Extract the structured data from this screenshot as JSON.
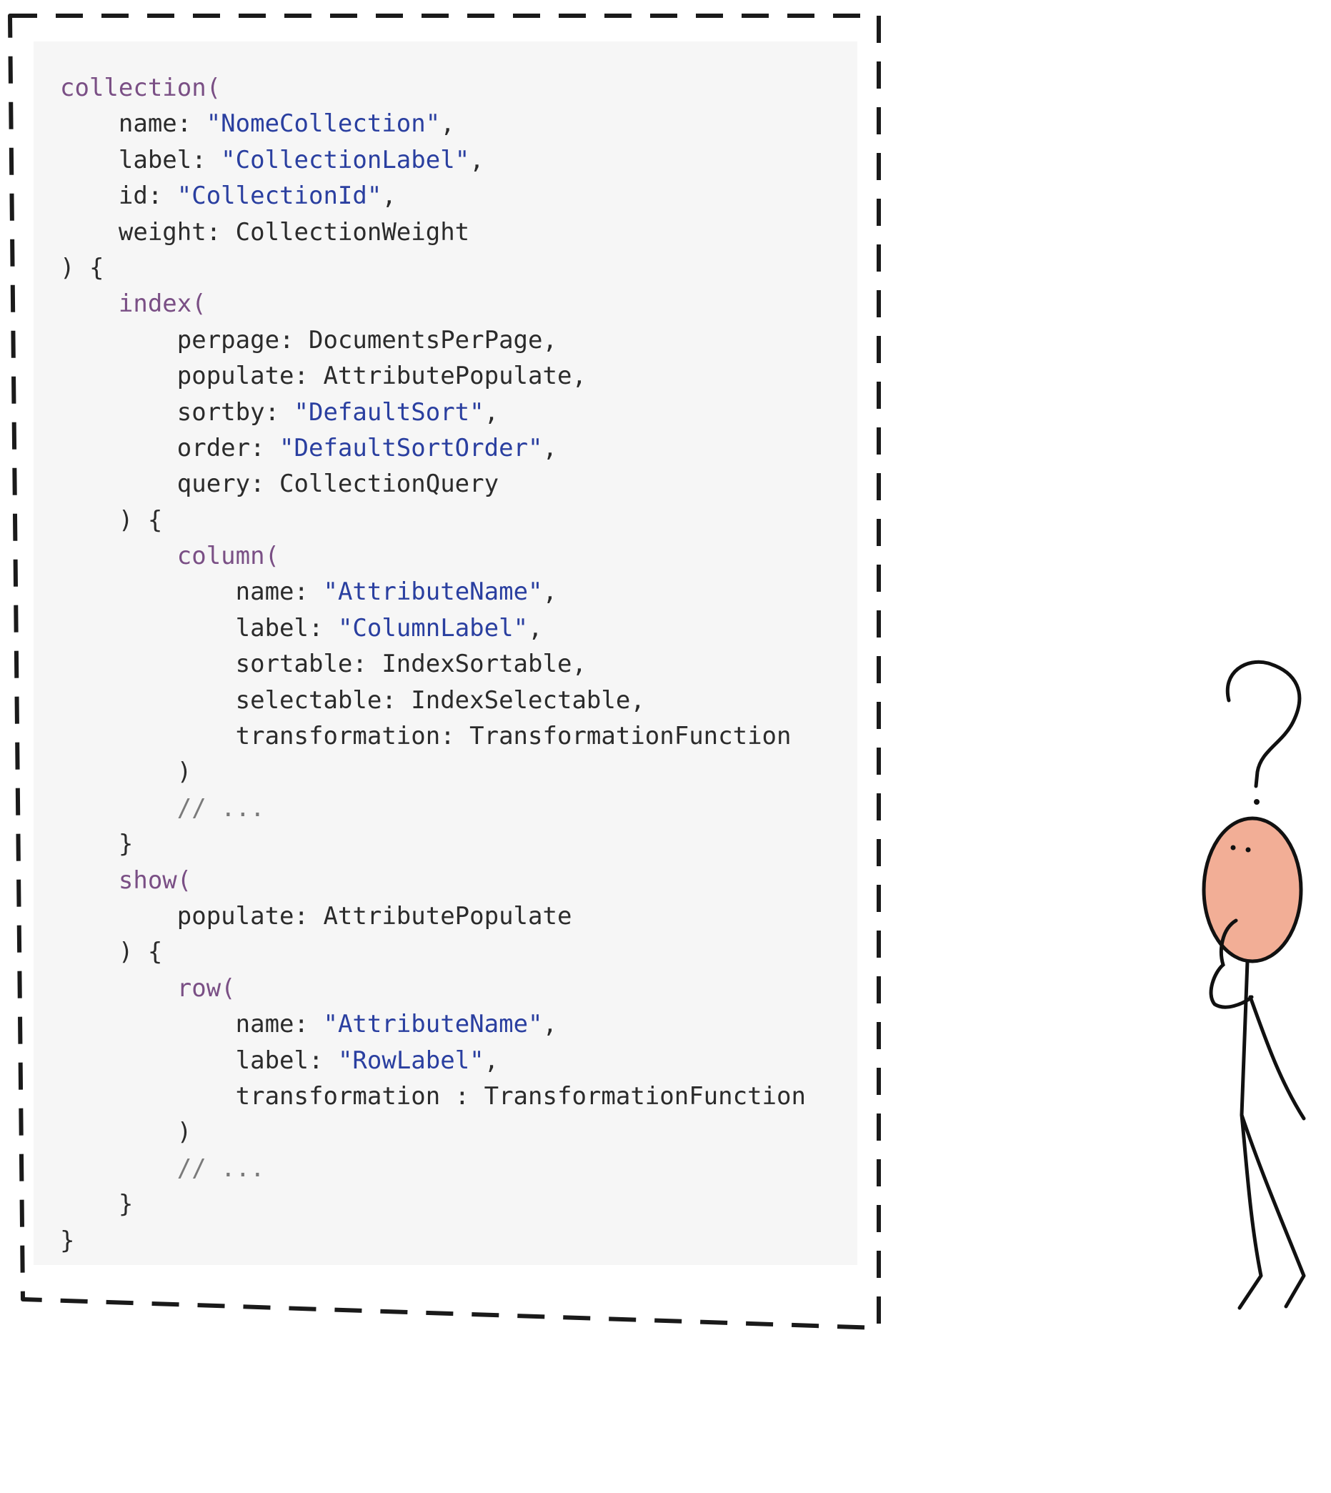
{
  "code": {
    "lines": [
      [
        {
          "t": "collection(",
          "c": "kw"
        }
      ],
      [
        {
          "t": "    name: ",
          "c": "plain"
        },
        {
          "t": "\"NomeCollection\"",
          "c": "str"
        },
        {
          "t": ",",
          "c": "plain"
        }
      ],
      [
        {
          "t": "    label: ",
          "c": "plain"
        },
        {
          "t": "\"CollectionLabel\"",
          "c": "str"
        },
        {
          "t": ",",
          "c": "plain"
        }
      ],
      [
        {
          "t": "    id: ",
          "c": "plain"
        },
        {
          "t": "\"CollectionId\"",
          "c": "str"
        },
        {
          "t": ",",
          "c": "plain"
        }
      ],
      [
        {
          "t": "    weight: CollectionWeight",
          "c": "plain"
        }
      ],
      [
        {
          "t": ") {",
          "c": "plain"
        }
      ],
      [
        {
          "t": "    ",
          "c": "plain"
        },
        {
          "t": "index(",
          "c": "kw"
        }
      ],
      [
        {
          "t": "        perpage: DocumentsPerPage,",
          "c": "plain"
        }
      ],
      [
        {
          "t": "        populate: AttributePopulate,",
          "c": "plain"
        }
      ],
      [
        {
          "t": "        sortby: ",
          "c": "plain"
        },
        {
          "t": "\"DefaultSort\"",
          "c": "str"
        },
        {
          "t": ",",
          "c": "plain"
        }
      ],
      [
        {
          "t": "        order: ",
          "c": "plain"
        },
        {
          "t": "\"DefaultSortOrder\"",
          "c": "str"
        },
        {
          "t": ",",
          "c": "plain"
        }
      ],
      [
        {
          "t": "        query: CollectionQuery",
          "c": "plain"
        }
      ],
      [
        {
          "t": "    ) {",
          "c": "plain"
        }
      ],
      [
        {
          "t": "        ",
          "c": "plain"
        },
        {
          "t": "column(",
          "c": "kw"
        }
      ],
      [
        {
          "t": "            name: ",
          "c": "plain"
        },
        {
          "t": "\"AttributeName\"",
          "c": "str"
        },
        {
          "t": ",",
          "c": "plain"
        }
      ],
      [
        {
          "t": "            label: ",
          "c": "plain"
        },
        {
          "t": "\"ColumnLabel\"",
          "c": "str"
        },
        {
          "t": ",",
          "c": "plain"
        }
      ],
      [
        {
          "t": "            sortable: IndexSortable,",
          "c": "plain"
        }
      ],
      [
        {
          "t": "            selectable: IndexSelectable,",
          "c": "plain"
        }
      ],
      [
        {
          "t": "            transformation: TransformationFunction",
          "c": "plain"
        }
      ],
      [
        {
          "t": "        )",
          "c": "plain"
        }
      ],
      [
        {
          "t": "        // ...",
          "c": "cmt"
        }
      ],
      [
        {
          "t": "    }",
          "c": "plain"
        }
      ],
      [
        {
          "t": "    ",
          "c": "plain"
        },
        {
          "t": "show(",
          "c": "kw"
        }
      ],
      [
        {
          "t": "        populate: AttributePopulate",
          "c": "plain"
        }
      ],
      [
        {
          "t": "    ) {",
          "c": "plain"
        }
      ],
      [
        {
          "t": "        ",
          "c": "plain"
        },
        {
          "t": "row(",
          "c": "kw"
        }
      ],
      [
        {
          "t": "            name: ",
          "c": "plain"
        },
        {
          "t": "\"AttributeName\"",
          "c": "str"
        },
        {
          "t": ",",
          "c": "plain"
        }
      ],
      [
        {
          "t": "            label: ",
          "c": "plain"
        },
        {
          "t": "\"RowLabel\"",
          "c": "str"
        },
        {
          "t": ",",
          "c": "plain"
        }
      ],
      [
        {
          "t": "            transformation : TransformationFunction",
          "c": "plain"
        }
      ],
      [
        {
          "t": "        )",
          "c": "plain"
        }
      ],
      [
        {
          "t": "        // ...",
          "c": "cmt"
        }
      ],
      [
        {
          "t": "    }",
          "c": "plain"
        }
      ],
      [
        {
          "t": "}",
          "c": "plain"
        }
      ]
    ]
  },
  "colors": {
    "panel_background": "#f6f6f6",
    "keyword": "#7a4f85",
    "string": "#2a3fa0",
    "text": "#2b2b2b",
    "frame_stroke": "#1a1a1a",
    "figure_head": "#f2ae96"
  },
  "figure": {
    "description_icon": "thinking-stick-figure-icon",
    "question_icon": "question-mark-icon"
  }
}
